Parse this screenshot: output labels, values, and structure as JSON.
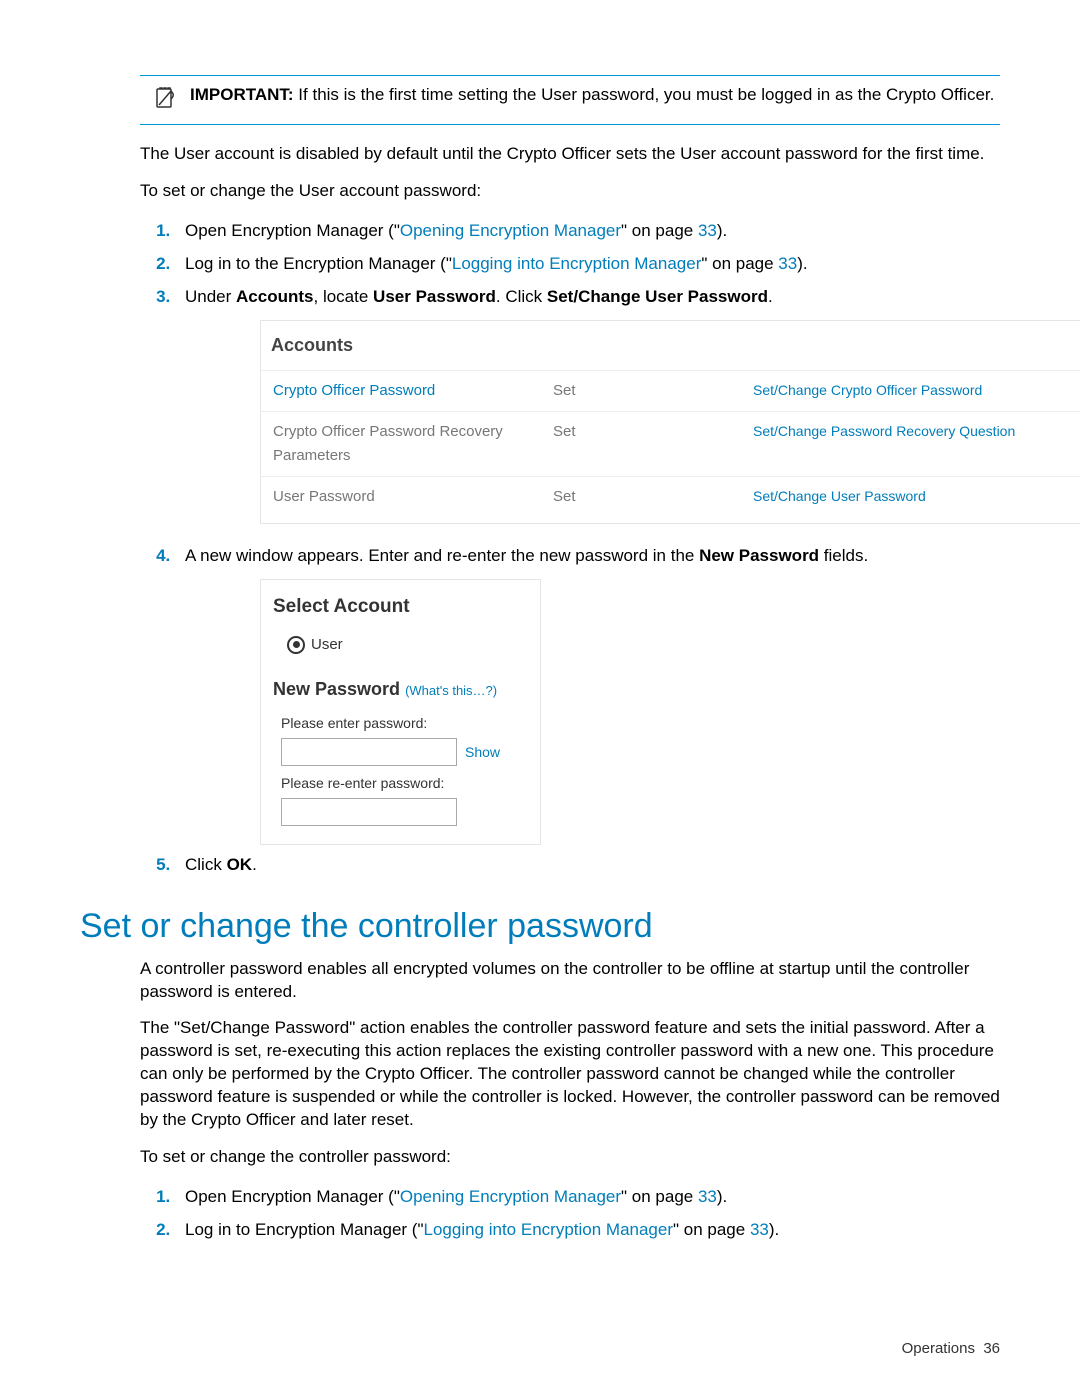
{
  "important": {
    "label": "IMPORTANT:",
    "text": "If this is the first time setting the User password, you must be logged in as the Crypto Officer."
  },
  "p1": "The User account is disabled by default until the Crypto Officer sets the User account password for the first time.",
  "p2": "To set or change the User account password:",
  "steps1": {
    "s1a": "Open Encryption Manager (\"",
    "s1link": "Opening Encryption Manager",
    "s1b": "\" on page ",
    "s1page": "33",
    "s1c": ").",
    "s2a": "Log in to the Encryption Manager (\"",
    "s2link": "Logging into Encryption Manager",
    "s2b": "\" on page ",
    "s2page": "33",
    "s2c": ").",
    "s3a": "Under ",
    "s3b": "Accounts",
    "s3c": ", locate ",
    "s3d": "User Password",
    "s3e": ". Click ",
    "s3f": "Set/Change User Password",
    "s3g": "."
  },
  "accounts": {
    "heading": "Accounts",
    "rows": [
      {
        "name": "Crypto Officer Password",
        "status": "Set",
        "action": "Set/Change Crypto Officer Password"
      },
      {
        "name": "Crypto Officer Password Recovery Parameters",
        "status": "Set",
        "action": "Set/Change Password Recovery Question"
      },
      {
        "name": "User Password",
        "status": "Set",
        "action": "Set/Change User Password"
      }
    ]
  },
  "step4a": "A new window appears. Enter and re-enter the new password in the ",
  "step4b": "New Password",
  "step4c": " fields.",
  "select": {
    "heading": "Select Account",
    "radio": "User",
    "np": "New Password",
    "whats": "(What's this…?)",
    "lbl1": "Please enter password:",
    "show": "Show",
    "lbl2": "Please re-enter password:"
  },
  "step5a": "Click ",
  "step5b": "OK",
  "step5c": ".",
  "h2": "Set or change the controller password",
  "cp1": "A controller password enables all encrypted volumes on the controller to be offline at startup until the controller password is entered.",
  "cp2": "The \"Set/Change Password\" action enables the controller password feature and sets the initial password. After a password is set, re-executing this action replaces the existing controller password with a new one. This procedure can only be performed by the Crypto Officer. The controller password cannot be changed while the controller password feature is suspended or while the controller is locked. However, the controller password can be removed by the Crypto Officer and later reset.",
  "cp3": "To set or change the controller password:",
  "steps2": {
    "s1a": "Open Encryption Manager (\"",
    "s1link": "Opening Encryption Manager",
    "s1b": "\" on page ",
    "s1page": "33",
    "s1c": ").",
    "s2a": "Log in to Encryption Manager (\"",
    "s2link": "Logging into Encryption Manager",
    "s2b": "\" on page ",
    "s2page": "33",
    "s2c": ")."
  },
  "footer": {
    "label": "Operations",
    "page": "36"
  }
}
